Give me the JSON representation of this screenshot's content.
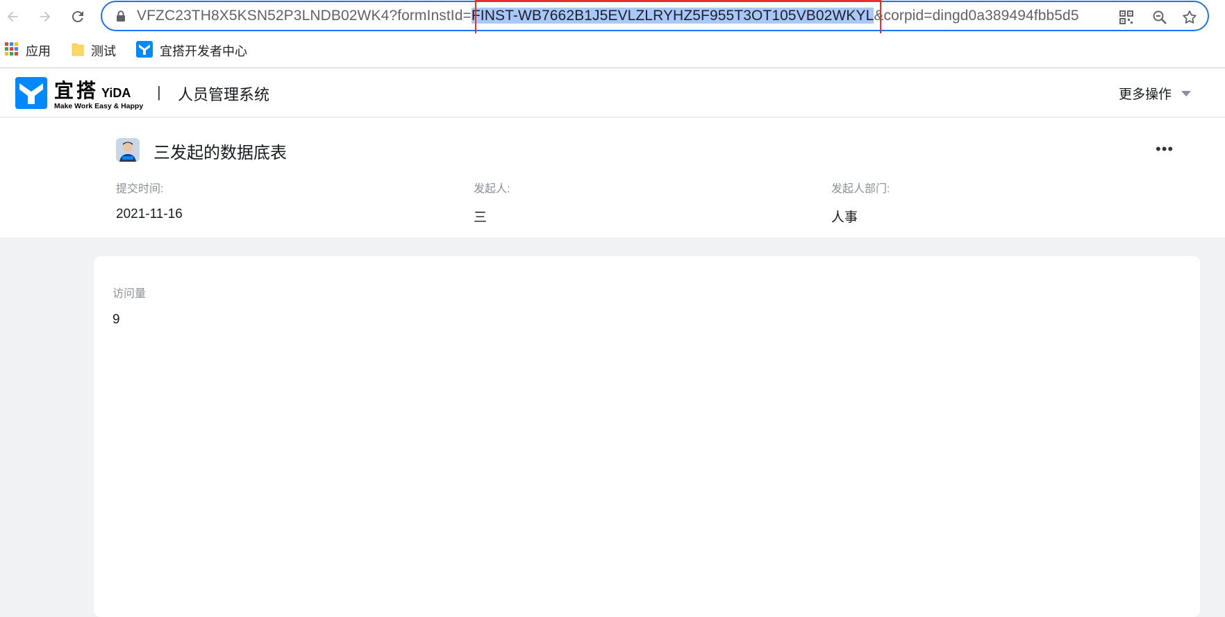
{
  "browser": {
    "url_prefix": "VFZC23TH8X5KSN52P3LNDB02WK4?formInstId=",
    "url_highlight": "FINST-WB7662B1J5EVLZLRYHZ5F955T3OT105VB02WKYL",
    "url_suffix": "&corpid=dingd0a389494fbb5d5"
  },
  "bookmarks": [
    {
      "label": "应用",
      "icon": "apps-grid-icon"
    },
    {
      "label": "测试",
      "icon": "folder-icon"
    },
    {
      "label": "宜搭开发者中心",
      "icon": "yida-logo-icon"
    }
  ],
  "app": {
    "brand_cn": "宜搭",
    "brand_en": "YiDA",
    "brand_tagline": "Make Work Easy & Happy",
    "separator": "|",
    "system_title": "人员管理系统",
    "more_actions": "更多操作"
  },
  "record": {
    "title": "三发起的数据底表",
    "more_icon": "•••",
    "meta": [
      {
        "label": "提交时间:",
        "value": "2021-11-16"
      },
      {
        "label": "发起人:",
        "value": "三"
      },
      {
        "label": "发起人部门:",
        "value": "人事"
      }
    ]
  },
  "form": {
    "field_label": "访问量",
    "field_value": "9"
  },
  "colors": {
    "accent": "#1a73e8",
    "brand_blue": "#0089ff",
    "highlight_box": "#e03030",
    "selection": "#a8c7fa"
  }
}
